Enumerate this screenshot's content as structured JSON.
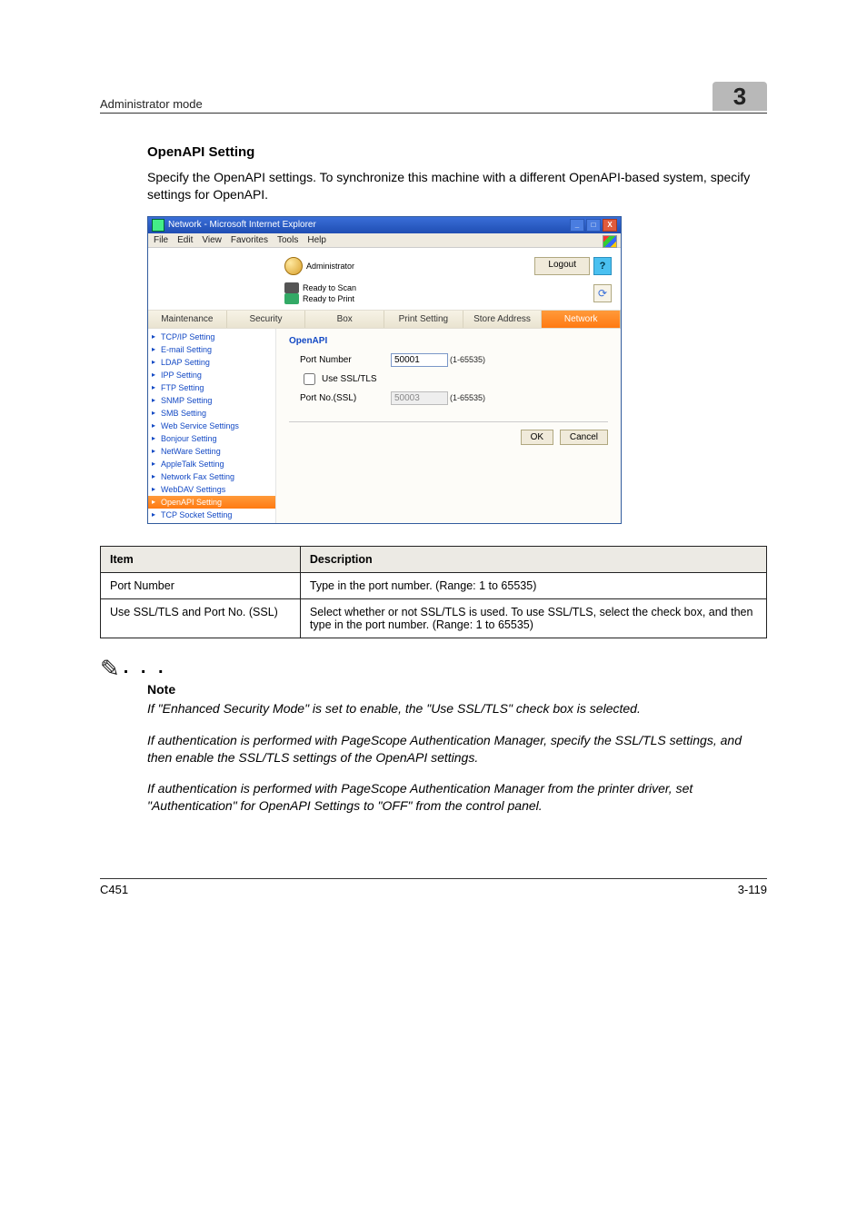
{
  "header": {
    "breadcrumb": "Administrator mode",
    "chapter": "3"
  },
  "section": {
    "title": "OpenAPI Setting",
    "body": "Specify the OpenAPI settings. To synchronize this machine with a different OpenAPI-based system, specify settings for OpenAPI."
  },
  "browser": {
    "window_title": "Network - Microsoft Internet Explorer",
    "menus": [
      "File",
      "Edit",
      "View",
      "Favorites",
      "Tools",
      "Help"
    ],
    "admin_label": "Administrator",
    "status": {
      "scan": "Ready to Scan",
      "print": "Ready to Print"
    },
    "logout": "Logout",
    "help": "?",
    "refresh": "⟳",
    "tabs": [
      "Maintenance",
      "Security",
      "Box",
      "Print Setting",
      "Store Address",
      "Network"
    ],
    "active_tab_index": 5,
    "sidenav": [
      "TCP/IP Setting",
      "E-mail Setting",
      "LDAP Setting",
      "IPP Setting",
      "FTP Setting",
      "SNMP Setting",
      "SMB Setting",
      "Web Service Settings",
      "Bonjour Setting",
      "NetWare Setting",
      "AppleTalk Setting",
      "Network Fax Setting",
      "WebDAV Settings",
      "OpenAPI Setting",
      "TCP Socket Setting"
    ],
    "sidenav_selected_index": 13,
    "panel": {
      "title": "OpenAPI",
      "port_label": "Port Number",
      "port_value": "50001",
      "range_text": "(1-65535)",
      "ssl_checkbox_label": "Use SSL/TLS",
      "ssl_checked": false,
      "ssl_port_label": "Port No.(SSL)",
      "ssl_port_value": "50003",
      "ok": "OK",
      "cancel": "Cancel"
    }
  },
  "table": {
    "headers": [
      "Item",
      "Description"
    ],
    "rows": [
      [
        "Port Number",
        "Type in the port number. (Range: 1 to 65535)"
      ],
      [
        "Use SSL/TLS and Port No. (SSL)",
        "Select whether or not SSL/TLS is used. To use SSL/TLS, select the check box, and then type in the port number. (Range: 1 to 65535)"
      ]
    ]
  },
  "note": {
    "label": "Note",
    "paragraphs": [
      "If \"Enhanced Security Mode\" is set to enable, the \"Use SSL/TLS\" check box is selected.",
      "If authentication is performed with PageScope Authentication Manager, specify the SSL/TLS settings, and then enable the SSL/TLS settings of the OpenAPI settings.",
      "If authentication is performed with PageScope Authentication Manager from the printer driver, set \"Authentication\" for OpenAPI Settings to \"OFF\" from the control panel."
    ]
  },
  "footer": {
    "left": "C451",
    "right": "3-119"
  }
}
